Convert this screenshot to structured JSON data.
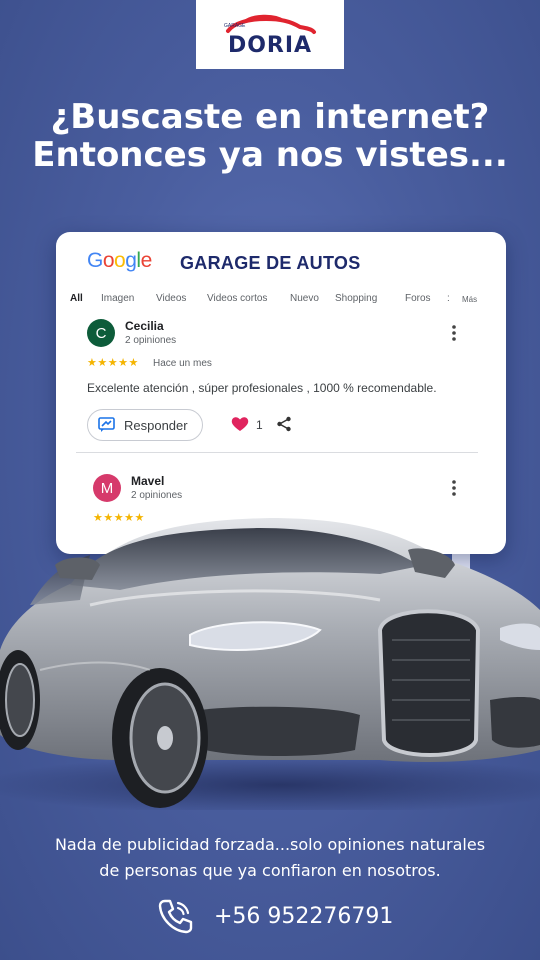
{
  "brand": {
    "small_text": "GARAGE",
    "name": "DORIA",
    "accent_color": "#e0242f",
    "navy_color": "#1e2a6b"
  },
  "headline": {
    "line1": "¿Buscaste en internet?",
    "line2": "Entonces ya nos vistes..."
  },
  "search_card": {
    "google_logo": [
      "G",
      "o",
      "o",
      "g",
      "l",
      "e"
    ],
    "title": "GARAGE DE AUTOS",
    "tabs": [
      {
        "label": "All",
        "active": true
      },
      {
        "label": "Imagen",
        "active": false
      },
      {
        "label": "Videos",
        "active": false
      },
      {
        "label": "Videos cortos",
        "active": false
      },
      {
        "label": "Nuevo",
        "active": false
      },
      {
        "label": "Shopping",
        "active": false
      },
      {
        "label": "Foros",
        "active": false
      },
      {
        "label": ":",
        "active": false
      },
      {
        "label": "Más",
        "active": false
      }
    ],
    "reviews": [
      {
        "initial": "C",
        "avatar_color": "#0d5c3a",
        "name": "Cecilia",
        "count": "2 opiniones",
        "stars": "★★★★★",
        "rating": 5,
        "when": "Hace un mes",
        "text": "Excelente atención , súper profesionales , 1000 % recomendable.",
        "reply_label": "Responder",
        "likes": "1"
      },
      {
        "initial": "M",
        "avatar_color": "#d63a6b",
        "name": "Mavel",
        "count": "2 opiniones",
        "stars": "★★★★★"
      }
    ]
  },
  "footer": {
    "line1": "Nada de publicidad forzada...solo opiniones naturales",
    "line2": "de personas que ya confiaron en nosotros.",
    "phone": "+56 952276791"
  },
  "icons": {
    "reply": "reply-icon",
    "heart": "heart-icon",
    "share": "share-icon",
    "more": "more-vert-icon",
    "phone": "phone-icon",
    "car": "car-illustration"
  }
}
